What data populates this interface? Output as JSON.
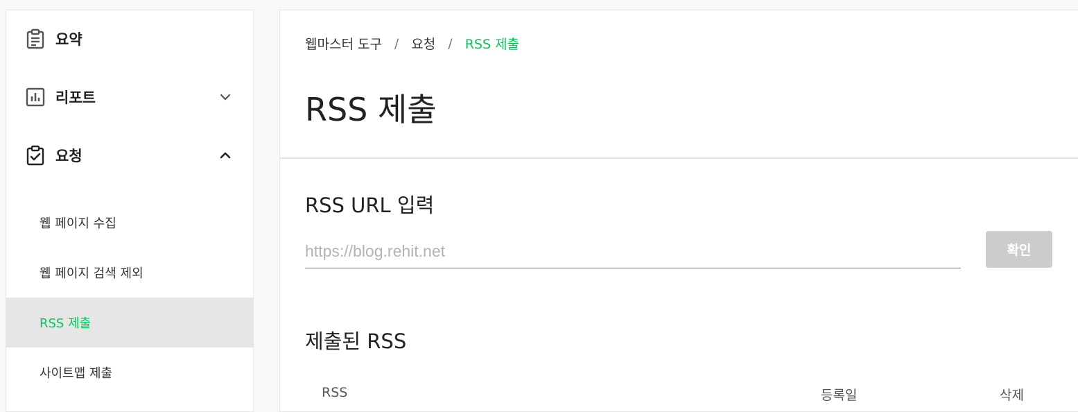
{
  "sidebar": {
    "items": [
      {
        "label": "요약",
        "icon": "clipboard-icon"
      },
      {
        "label": "리포트",
        "icon": "bar-chart-icon",
        "expanded": false
      },
      {
        "label": "요청",
        "icon": "clipboard-check-icon",
        "expanded": true
      }
    ],
    "sub_items": [
      {
        "label": "웹 페이지 수집"
      },
      {
        "label": "웹 페이지 검색 제외"
      },
      {
        "label": "RSS 제출",
        "active": true
      },
      {
        "label": "사이트맵 제출"
      }
    ]
  },
  "breadcrumb": {
    "items": [
      "웹마스터 도구",
      "요청",
      "RSS 제출"
    ],
    "separator": "/"
  },
  "page": {
    "title": "RSS 제출"
  },
  "rss_form": {
    "section_title": "RSS URL 입력",
    "input_value": "",
    "input_placeholder": "https://blog.rehit.net",
    "confirm_label": "확인"
  },
  "submitted": {
    "section_title": "제출된 RSS",
    "columns": [
      "RSS",
      "등록일",
      "삭제"
    ]
  },
  "colors": {
    "accent": "#03c75a",
    "active_bg": "#e6e6e6",
    "button_disabled": "#cccccc"
  }
}
